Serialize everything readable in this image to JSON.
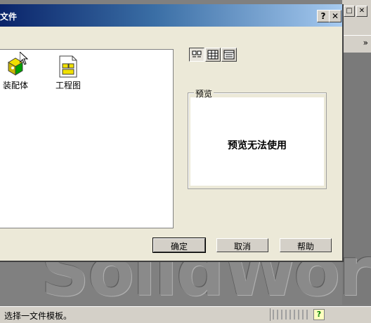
{
  "dialog": {
    "title": "文件",
    "help_button": "?",
    "close_button": "✕"
  },
  "files": [
    {
      "label": "装配体",
      "icon": "assembly-icon"
    },
    {
      "label": "工程图",
      "icon": "drawing-icon"
    }
  ],
  "view_buttons": [
    {
      "icon": "large-icons-icon",
      "active": true
    },
    {
      "icon": "list-icon",
      "active": false
    },
    {
      "icon": "details-icon",
      "active": false
    }
  ],
  "preview": {
    "label": "预览",
    "message": "预览无法使用"
  },
  "buttons": {
    "ok": "确定",
    "cancel": "取消",
    "help": "帮助"
  },
  "app": {
    "chevron": "»",
    "window_button": "□",
    "close_button": "✕",
    "watermark": "SolidWorks"
  },
  "status": {
    "text": "选择一文件模板。",
    "help_icon": "?"
  }
}
